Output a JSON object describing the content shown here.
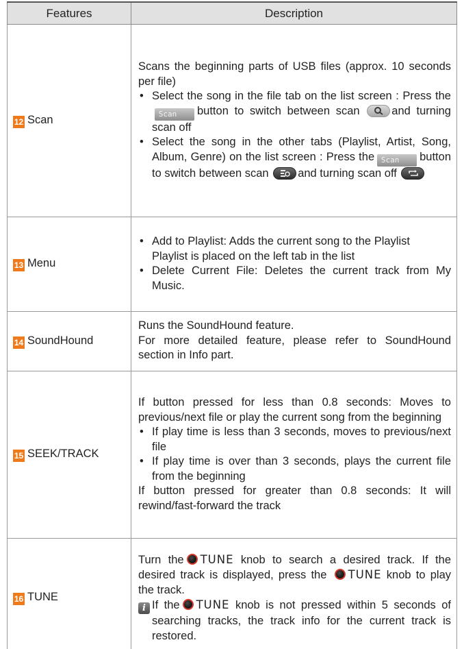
{
  "header": {
    "features": "Features",
    "description": "Description"
  },
  "rows": [
    {
      "num": "12",
      "feature": "Scan",
      "intro": "Scans the beginning parts of USB files (approx. 10 seconds per file)",
      "b1_pre": "Select the song in the file tab on the list screen : Press the",
      "b1_mid": "button to switch between scan",
      "b1_post": "and turning scan off",
      "b2_pre": "Select the song in the other tabs (Playlist, Artist, Song, Album, Genre) on the list screen : Press the",
      "b2_mid": "button to switch between scan",
      "b2_post": "and turning scan off",
      "btn": "Scan"
    },
    {
      "num": "13",
      "feature": "Menu",
      "b1": "Add to Playlist: Adds the current song to the Playlist",
      "b1_cont": "Playlist is placed on the left tab in the list",
      "b2": "Delete Current File: Deletes the current track from My Music."
    },
    {
      "num": "14",
      "feature": "SoundHound",
      "line1": "Runs the SoundHound feature.",
      "line2": "For more detailed feature, please refer to SoundHound section in Info part."
    },
    {
      "num": "15",
      "feature": "SEEK/TRACK",
      "intro": "If button pressed for less than 0.8 seconds: Moves to previous/next file or play the current song from the beginning",
      "b1": "If play time is less than 3 seconds, moves to previous/next file",
      "b2": "If play time is over than 3 seconds, plays the current file from the beginning",
      "outro": "If button pressed for greater than 0.8 seconds: It will rewind/fast-forward the track"
    },
    {
      "num": "16",
      "feature": "TUNE",
      "p1_pre": "Turn the",
      "p1_post": "knob to search a desired track. If the desired track is displayed, press the",
      "p2_post": "knob to play the track.",
      "note_pre": "If the",
      "note_post": "knob is not pressed within 5 seconds of searching tracks, the track info for the current track is restored.",
      "tune": "TUNE",
      "info": "i"
    }
  ],
  "colors": {
    "badge": "#ef7a1b",
    "header_bg": "#e1e1e1",
    "knob_ring": "#d33a2c"
  },
  "icons": [
    "scan-button-icon",
    "scan-folder-icon",
    "scan-list-icon",
    "repeat-off-icon",
    "tune-knob-icon",
    "info-icon"
  ]
}
